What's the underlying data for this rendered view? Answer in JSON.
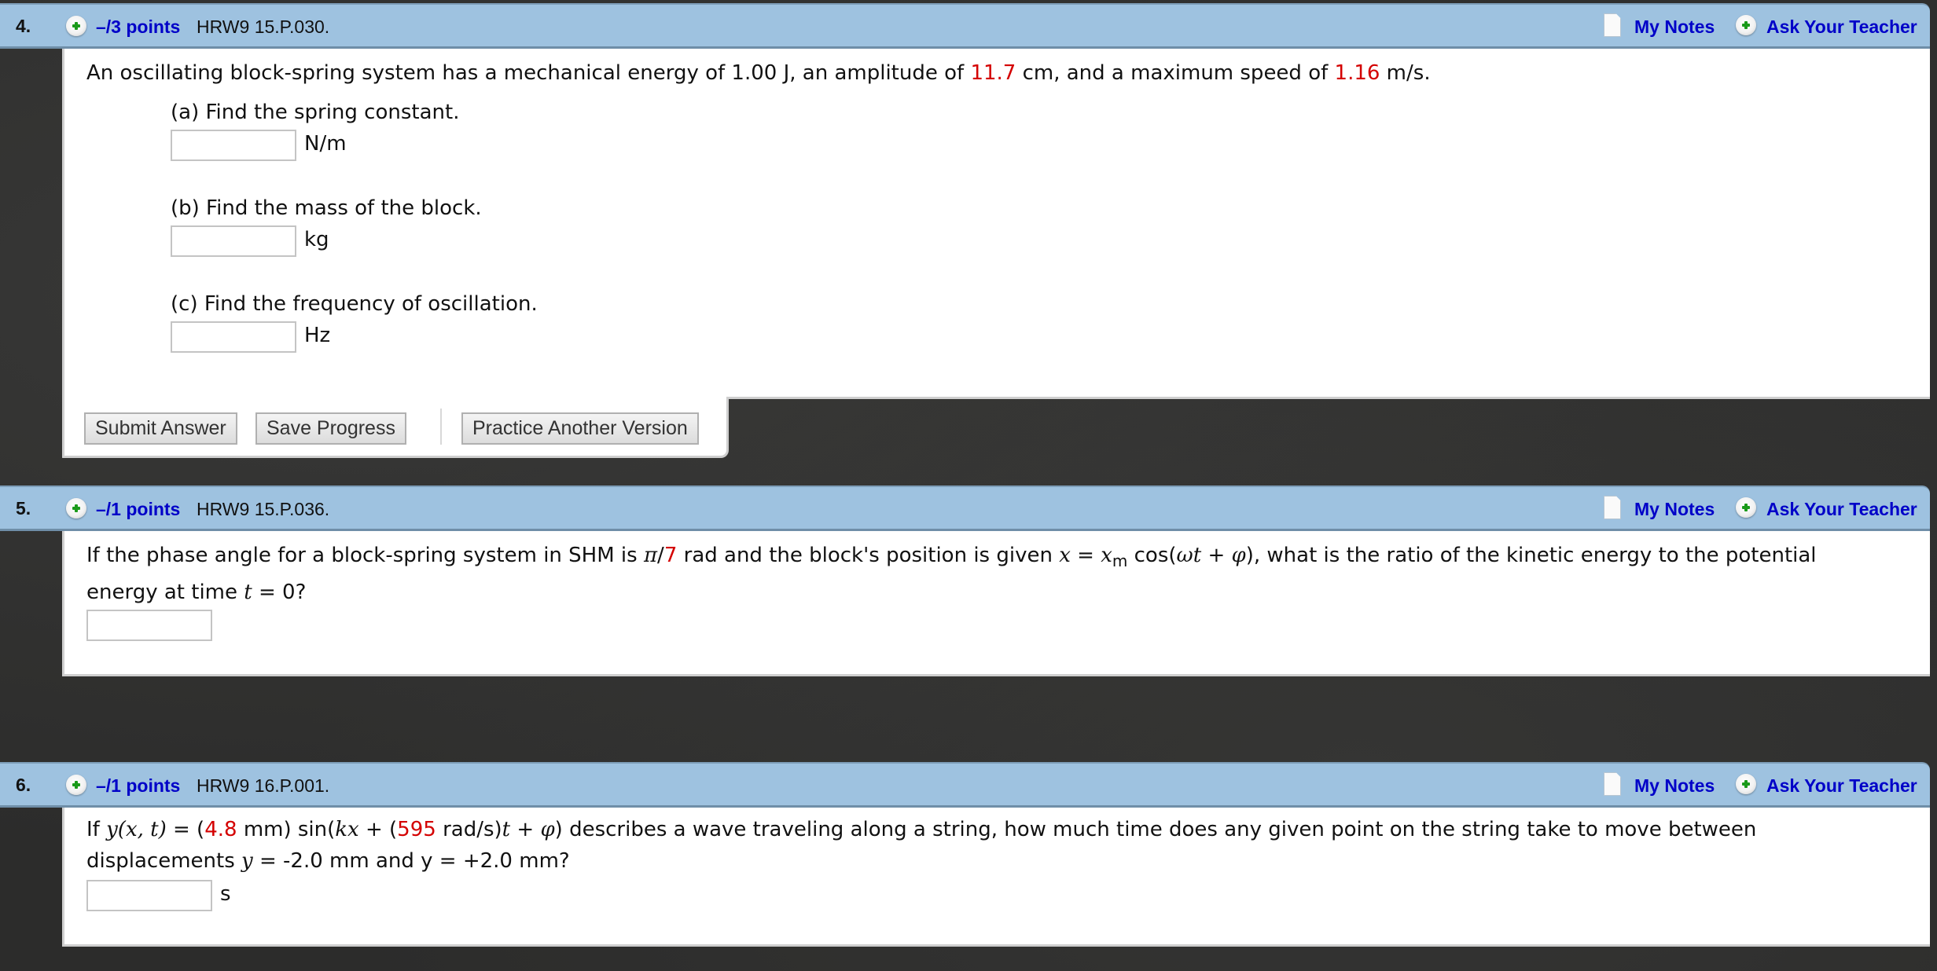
{
  "header_icons": {
    "expand": "plus-circle-icon",
    "notes": "document-icon",
    "ask": "plus-circle-icon"
  },
  "colors": {
    "header_bg": "#9ec2e0",
    "link": "#0000c8",
    "highlight": "#d40000",
    "plus": "#1a9a1a"
  },
  "questions": [
    {
      "number": "4.",
      "points": "–/3 points",
      "code": "HRW9 15.P.030.",
      "my_notes": "My Notes",
      "ask_teacher": "Ask Your Teacher",
      "text": {
        "p1": "An oscillating block-spring system has a mechanical energy of 1.00 J, an amplitude of ",
        "v1": "11.7",
        "p2": " cm, and a maximum speed of ",
        "v2": "1.16",
        "p3": " m/s."
      },
      "parts": [
        {
          "label": "(a) Find the spring constant.",
          "value": "",
          "unit": "N/m"
        },
        {
          "label": "(b) Find the mass of the block.",
          "value": "",
          "unit": "kg"
        },
        {
          "label": "(c) Find the frequency of oscillation.",
          "value": "",
          "unit": "Hz"
        }
      ],
      "buttons": {
        "submit": "Submit Answer",
        "save": "Save Progress",
        "practice": "Practice Another Version"
      }
    },
    {
      "number": "5.",
      "points": "–/1 points",
      "code": "HRW9 15.P.036.",
      "my_notes": "My Notes",
      "ask_teacher": "Ask Your Teacher",
      "text": {
        "p1": "If the phase angle for a block-spring system in SHM is ",
        "pi": "π",
        "slash": "/",
        "v1": "7",
        "p2": " rad and the block's position is given ",
        "x": "x",
        "eq": " = ",
        "xm": "x",
        "m": "m",
        "cos": " cos(",
        "wt": "ωt",
        "plus": " + ",
        "phi": "φ",
        "p3": "), what is the ratio of the kinetic energy to the potential",
        "line2a": "energy at time ",
        "t": "t",
        "line2b": " = 0?"
      },
      "answer": {
        "value": "",
        "unit": ""
      }
    },
    {
      "number": "6.",
      "points": "–/1 points",
      "code": "HRW9 16.P.001.",
      "my_notes": "My Notes",
      "ask_teacher": "Ask Your Teacher",
      "text": {
        "p1": "If ",
        "y": "y",
        "xt": "(x, t)",
        "p2": " = (",
        "v1": "4.8",
        "p3": " mm) sin(",
        "kx": "kx",
        "p4": " + (",
        "v2": "595",
        "p5": " rad/s)",
        "t": "t",
        "p6": " + ",
        "phi": "φ",
        "p7": ") describes a wave traveling along a string, how much time does any given point on the string take to move between",
        "line2a": "displacements ",
        "y2": "y",
        "line2b": " = -2.0 mm and y = +2.0 mm?"
      },
      "answer": {
        "value": "",
        "unit": "s"
      }
    }
  ]
}
